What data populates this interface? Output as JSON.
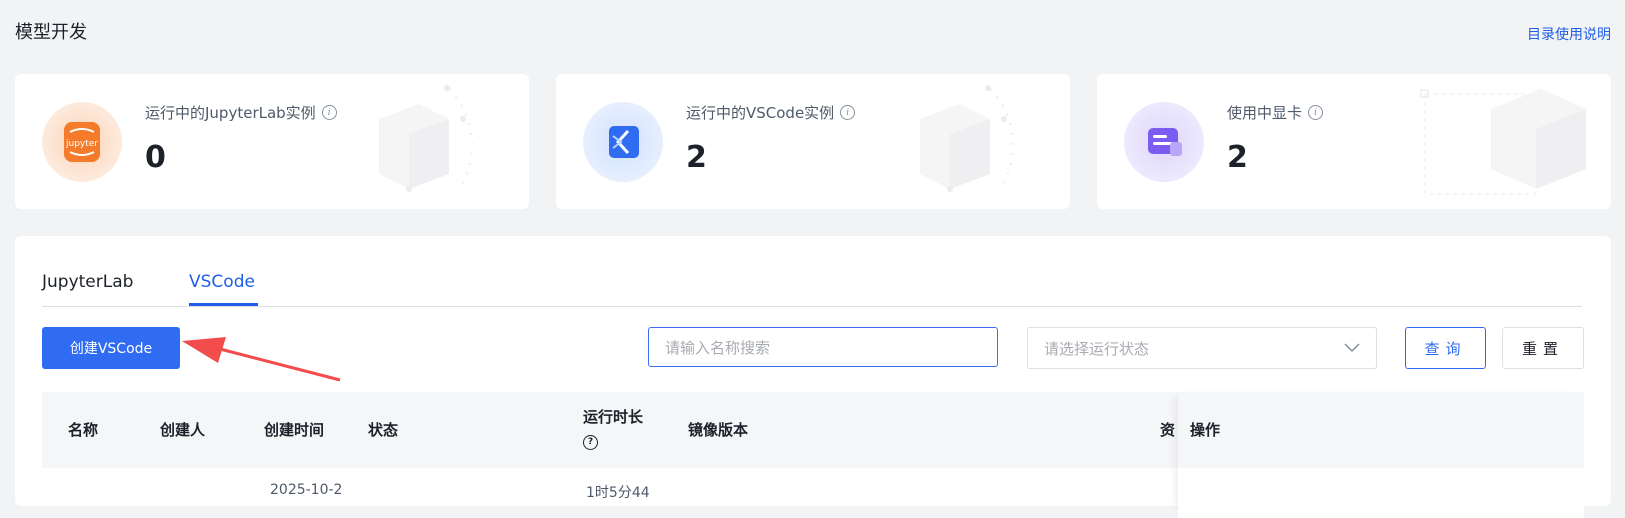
{
  "header": {
    "title": "模型开发",
    "help_link": "目录使用说明"
  },
  "stats": [
    {
      "label": "运行中的JupyterLab实例",
      "value": "0",
      "icon": "jupyter-icon",
      "icon_text": "jupyter"
    },
    {
      "label": "运行中的VSCode实例",
      "value": "2",
      "icon": "vscode-icon"
    },
    {
      "label": "使用中显卡",
      "value": "2",
      "icon": "gpu-card-icon"
    }
  ],
  "tabs": [
    {
      "label": "JupyterLab",
      "active": false
    },
    {
      "label": "VSCode",
      "active": true
    }
  ],
  "toolbar": {
    "create_label": "创建VSCode",
    "search_placeholder": "请输入名称搜索",
    "status_placeholder": "请选择运行状态",
    "query_label": "查询",
    "reset_label": "重置"
  },
  "table": {
    "columns": [
      "名称",
      "创建人",
      "创建时间",
      "状态",
      "运行时长",
      "镜像版本",
      "资",
      "操作"
    ],
    "partial_row": {
      "created": "2025-10-2",
      "duration": "1时5分44"
    }
  },
  "colors": {
    "primary": "#2f6cf2",
    "arrow": "#f24c4c"
  }
}
